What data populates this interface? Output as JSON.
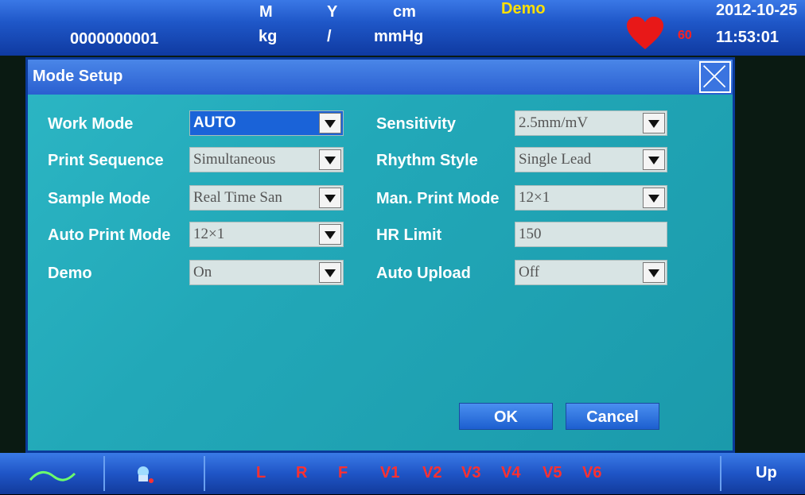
{
  "topbar": {
    "patient_id": "0000000001",
    "gender": "M",
    "age_unit": "Y",
    "height_unit": "cm",
    "demo_label": "Demo",
    "weight_unit": "kg",
    "separator": "/",
    "bp_unit": "mmHg",
    "heart_rate": "60",
    "date": "2012-10-25",
    "time": "11:53:01"
  },
  "dialog": {
    "title": "Mode Setup",
    "fields": {
      "work_mode": {
        "label": "Work Mode",
        "value": "AUTO"
      },
      "print_sequence": {
        "label": "Print Sequence",
        "value": "Simultaneous"
      },
      "sample_mode": {
        "label": "Sample Mode",
        "value": "Real Time San"
      },
      "auto_print_mode": {
        "label": "Auto Print Mode",
        "value": "12×1"
      },
      "demo": {
        "label": "Demo",
        "value": "On"
      },
      "sensitivity": {
        "label": "Sensitivity",
        "value": "2.5mm/mV"
      },
      "rhythm_style": {
        "label": "Rhythm Style",
        "value": "Single Lead"
      },
      "man_print_mode": {
        "label": "Man. Print Mode",
        "value": "12×1"
      },
      "hr_limit": {
        "label": "HR Limit",
        "value": "150"
      },
      "auto_upload": {
        "label": "Auto Upload",
        "value": "Off"
      }
    },
    "ok_label": "OK",
    "cancel_label": "Cancel"
  },
  "bottombar": {
    "leads": [
      "L",
      "R",
      "F",
      "V1",
      "V2",
      "V3",
      "V4",
      "V5",
      "V6"
    ],
    "up_label": "Up"
  },
  "colors": {
    "dialog_bg": "#22a8b8",
    "bar_blue": "#1f57c8",
    "lead_red": "#ff3030",
    "demo_yellow": "#ffe000"
  }
}
